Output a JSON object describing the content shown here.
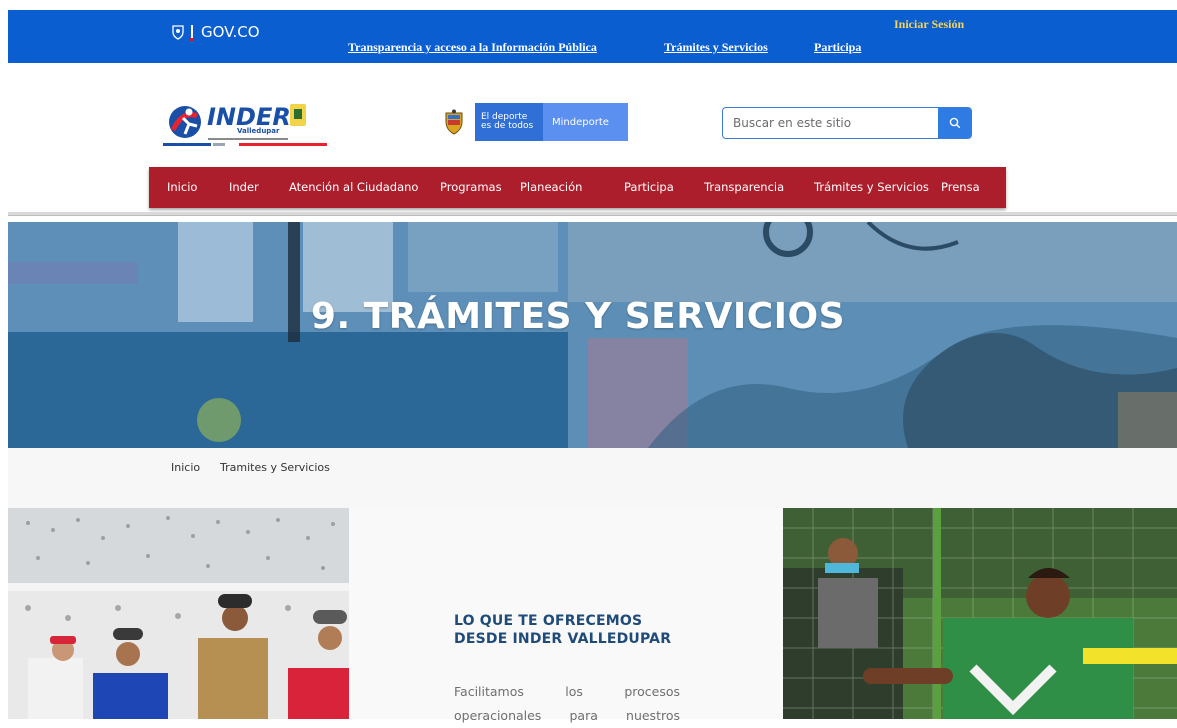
{
  "govbar": {
    "brand": "GOV.CO",
    "links": [
      "Transparencia y acceso a la Información Pública",
      "Trámites y Servicios",
      "Participa"
    ],
    "login": "Iniciar Sesión"
  },
  "header": {
    "logo_text": "INDER",
    "logo_subtext": "Valledupar",
    "mindeporte": {
      "slogan_line1": "El deporte",
      "slogan_line2": "es de todos",
      "brand": "Mindeporte"
    }
  },
  "search": {
    "placeholder": "Buscar en este sitio"
  },
  "nav": {
    "items": [
      "Inicio",
      "Inder",
      "Atención al Ciudadano",
      "Programas",
      "Planeación",
      "Participa",
      "Transparencia",
      "Trámites y Servicios",
      "Prensa"
    ]
  },
  "hero": {
    "title": "9. TRÁMITES Y SERVICIOS"
  },
  "breadcrumb": {
    "items": [
      "Inicio",
      "Tramites y Servicios"
    ]
  },
  "offer": {
    "title_line1": "LO QUE TE OFRECEMOS",
    "title_line2": "DESDE INDER VALLEDUPAR",
    "text_line1": "Facilitamos los procesos",
    "text_line2": "operacionales para nuestros"
  },
  "colors": {
    "govbar": "#0b5ecf",
    "nav": "#ac1e2b",
    "accent_blue": "#2d7be3",
    "heading": "#1f4b7a"
  }
}
